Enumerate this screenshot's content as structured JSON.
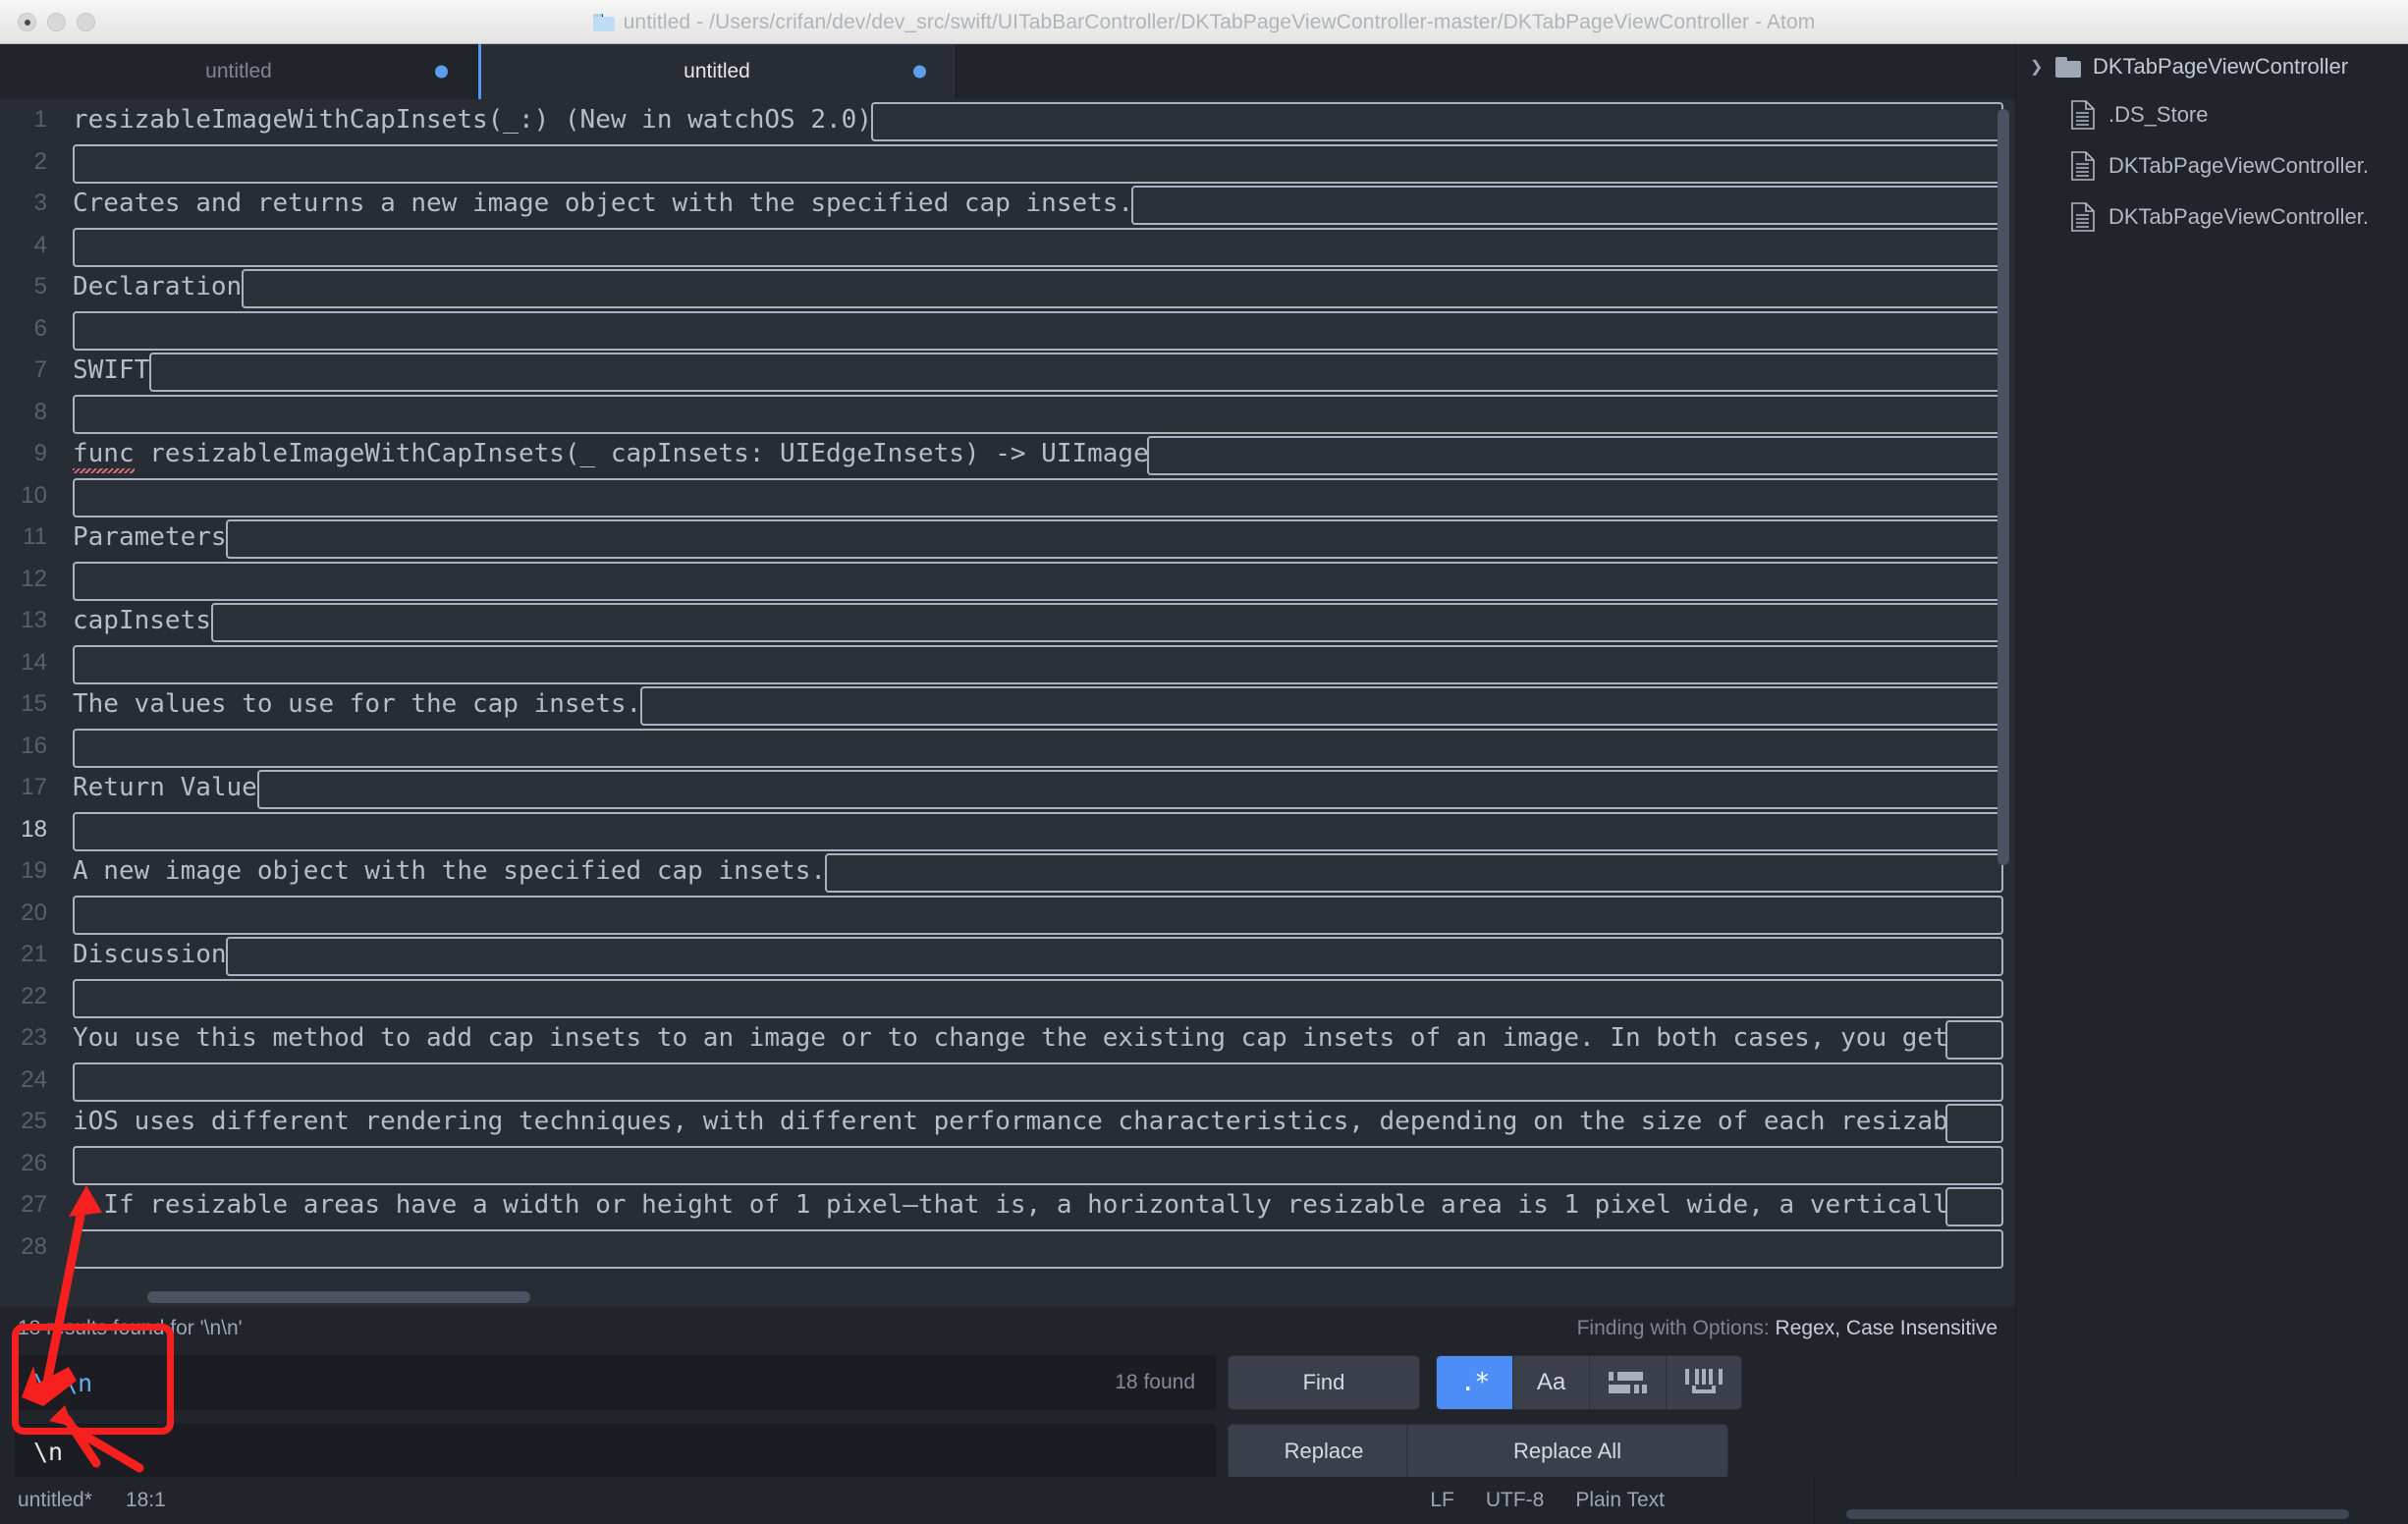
{
  "window": {
    "title": "untitled - /Users/crifan/dev/dev_src/swift/UITabBarController/DKTabPageViewController-master/DKTabPageViewController - Atom",
    "folder_icon": "folder-icon"
  },
  "tabs": [
    {
      "label": "untitled",
      "active": false,
      "modified": true
    },
    {
      "label": "untitled",
      "active": true,
      "modified": true
    }
  ],
  "editor": {
    "lines": [
      {
        "num": "1",
        "text": "resizableImageWithCapInsets(_:) (New in watchOS 2.0)"
      },
      {
        "num": "2",
        "text": ""
      },
      {
        "num": "3",
        "text": "Creates and returns a new image object with the specified cap insets."
      },
      {
        "num": "4",
        "text": ""
      },
      {
        "num": "5",
        "text": "Declaration"
      },
      {
        "num": "6",
        "text": ""
      },
      {
        "num": "7",
        "text": "SWIFT"
      },
      {
        "num": "8",
        "text": ""
      },
      {
        "num": "9",
        "text": "func resizableImageWithCapInsets(_ capInsets: UIEdgeInsets) -> UIImage"
      },
      {
        "num": "10",
        "text": ""
      },
      {
        "num": "11",
        "text": "Parameters"
      },
      {
        "num": "12",
        "text": ""
      },
      {
        "num": "13",
        "text": "capInsets"
      },
      {
        "num": "14",
        "text": ""
      },
      {
        "num": "15",
        "text": "The values to use for the cap insets."
      },
      {
        "num": "16",
        "text": ""
      },
      {
        "num": "17",
        "text": "Return Value"
      },
      {
        "num": "18",
        "text": ""
      },
      {
        "num": "19",
        "text": "A new image object with the specified cap insets."
      },
      {
        "num": "20",
        "text": ""
      },
      {
        "num": "21",
        "text": "Discussion"
      },
      {
        "num": "22",
        "text": ""
      },
      {
        "num": "23",
        "text": "You use this method to add cap insets to an image or to change the existing cap insets of an image. In both cases, you get"
      },
      {
        "num": "24",
        "text": ""
      },
      {
        "num": "25",
        "text": "iOS uses different rendering techniques, with different performance characteristics, depending on the size of each resizab"
      },
      {
        "num": "26",
        "text": ""
      },
      {
        "num": "27",
        "text": "- If resizable areas have a width or height of 1 pixel—that is, a horizontally resizable area is 1 pixel wide, a verticall"
      },
      {
        "num": "28",
        "text": ""
      }
    ],
    "cursor_line": "18"
  },
  "find": {
    "status": "18 results found for '\\n\\n'",
    "options_label_prefix": "Finding with Options: ",
    "options_label_value": "Regex, Case Insensitive",
    "find_value": "\\n\\n",
    "replace_value": "\\n",
    "found_badge": "18 found",
    "find_button": "Find",
    "replace_button": "Replace",
    "replace_all_button": "Replace All",
    "toggles": [
      {
        "name": "regex",
        "glyph": ".*",
        "active": true
      },
      {
        "name": "case-sensitive",
        "glyph": "Aa",
        "active": false
      },
      {
        "name": "whole-word",
        "glyph": "",
        "active": false
      },
      {
        "name": "in-selection",
        "glyph": "",
        "active": false
      }
    ]
  },
  "tree": {
    "root": "DKTabPageViewController",
    "files": [
      ".DS_Store",
      "DKTabPageViewController.",
      "DKTabPageViewController."
    ]
  },
  "status_bar": {
    "file": "untitled*",
    "position": "18:1",
    "line_ending": "LF",
    "encoding": "UTF-8",
    "grammar": "Plain Text"
  },
  "colors": {
    "accent": "#4d8df6",
    "annotation": "#f81f1f",
    "editor_bg": "#282c34",
    "chrome_bg": "#21252b"
  }
}
